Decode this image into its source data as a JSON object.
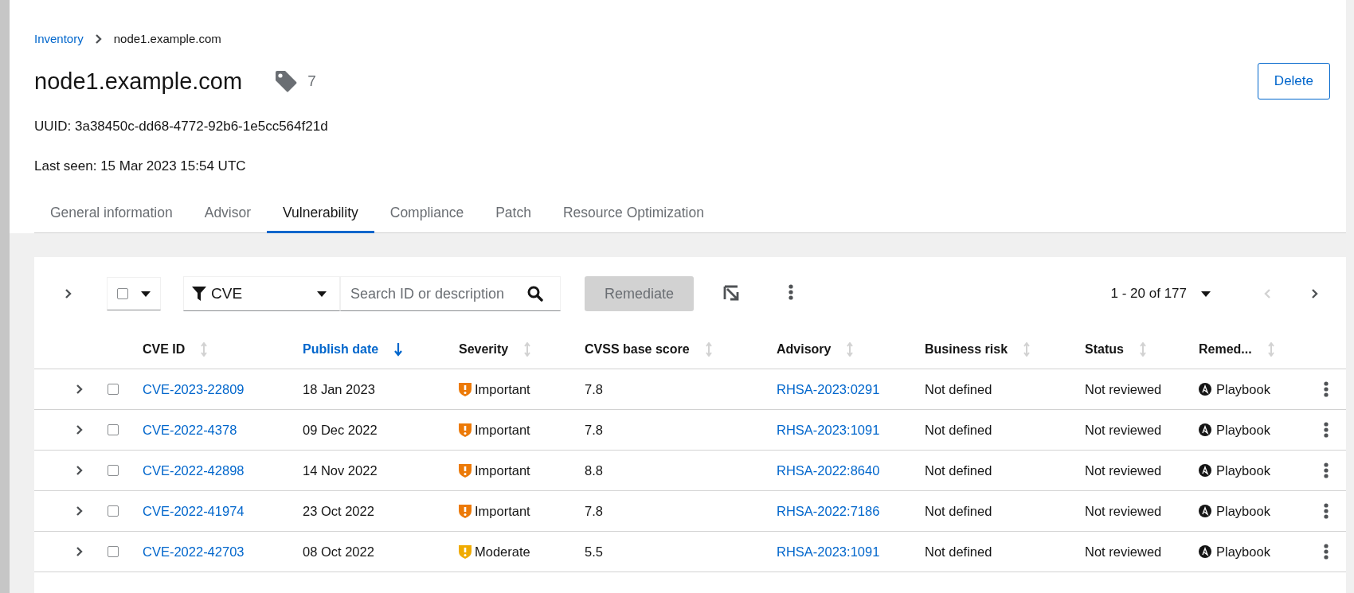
{
  "breadcrumb": [
    {
      "label": "Inventory",
      "link": true
    },
    {
      "label": "node1.example.com",
      "link": false
    }
  ],
  "header": {
    "title": "node1.example.com",
    "tag_count": "7",
    "delete_button": "Delete",
    "uuid": "UUID: 3a38450c-dd68-4772-92b6-1e5cc564f21d",
    "last_seen": "Last seen: 15 Mar 2023 15:54 UTC"
  },
  "tabs": [
    {
      "label": "General information",
      "selected": false
    },
    {
      "label": "Advisor",
      "selected": false
    },
    {
      "label": "Vulnerability",
      "selected": true
    },
    {
      "label": "Compliance",
      "selected": false
    },
    {
      "label": "Patch",
      "selected": false
    },
    {
      "label": "Resource Optimization",
      "selected": false
    }
  ],
  "toolbar": {
    "expand_all": {
      "expanded": false
    },
    "bulk_select": {
      "checked": false
    },
    "filter": {
      "label": "CVE"
    },
    "search": {
      "placeholder": "Search ID or description"
    },
    "remediate": {
      "label": "Remediate",
      "disabled": true
    },
    "pagination": {
      "text": "**1 - 20** of **177**",
      "prev_disabled": true,
      "next_disabled": false
    }
  },
  "table": {
    "columns": [
      {
        "label": "CVE ID",
        "sorted": false
      },
      {
        "label": "Publish date",
        "sorted": true
      },
      {
        "label": "Severity",
        "sorted": false
      },
      {
        "label": "CVSS base score",
        "sorted": false
      },
      {
        "label": "Advisory",
        "sorted": false
      },
      {
        "label": "Business risk",
        "sorted": false
      },
      {
        "label": "Status",
        "sorted": false
      },
      {
        "label": "Remed...",
        "sorted": false
      }
    ],
    "rows": [
      {
        "expanded": false,
        "checked": false,
        "cve": "CVE-2023-22809",
        "date": "18 Jan 2023",
        "severity": "Important",
        "color": "#ec7a08",
        "cvss": "7.8",
        "advisory": "RHSA-2023:0291",
        "risk": "Not defined",
        "status": "Not reviewed",
        "remediation": "Playbook"
      },
      {
        "expanded": false,
        "checked": false,
        "cve": "CVE-2022-4378",
        "date": "09 Dec 2022",
        "severity": "Important",
        "color": "#ec7a08",
        "cvss": "7.8",
        "advisory": "RHSA-2023:1091",
        "risk": "Not defined",
        "status": "Not reviewed",
        "remediation": "Playbook"
      },
      {
        "expanded": false,
        "checked": false,
        "cve": "CVE-2022-42898",
        "date": "14 Nov 2022",
        "severity": "Important",
        "color": "#ec7a08",
        "cvss": "8.8",
        "advisory": "RHSA-2022:8640",
        "risk": "Not defined",
        "status": "Not reviewed",
        "remediation": "Playbook"
      },
      {
        "expanded": false,
        "checked": false,
        "cve": "CVE-2022-41974",
        "date": "23 Oct 2022",
        "severity": "Important",
        "color": "#ec7a08",
        "cvss": "7.8",
        "advisory": "RHSA-2022:7186",
        "risk": "Not defined",
        "status": "Not reviewed",
        "remediation": "Playbook"
      },
      {
        "expanded": false,
        "checked": false,
        "cve": "CVE-2022-42703",
        "date": "08 Oct 2022",
        "severity": "Moderate",
        "color": "#f0ab00",
        "cvss": "5.5",
        "advisory": "RHSA-2023:1091",
        "risk": "Not defined",
        "status": "Not reviewed",
        "remediation": "Playbook"
      }
    ]
  }
}
